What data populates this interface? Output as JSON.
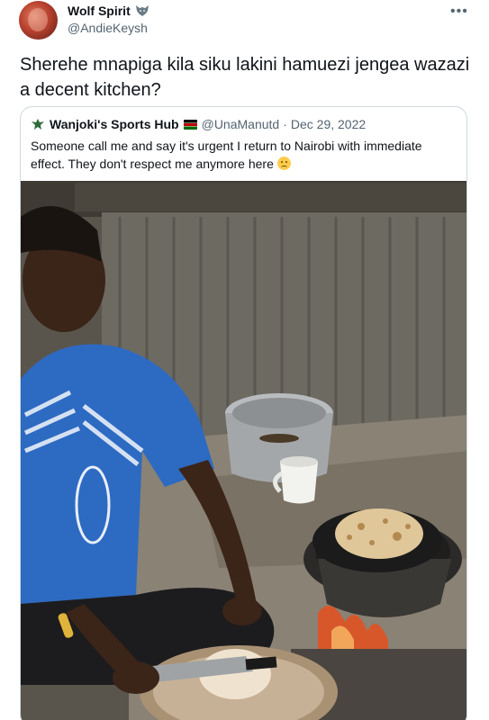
{
  "tweet": {
    "author_name": "Wolf Spirit",
    "author_handle": "@AndieKeysh",
    "text": "Sherehe mnapiga kila siku lakini hamuezi jengea wazazi a decent kitchen?",
    "more_icon": "more-horizontal-icon",
    "badge_icon": "wolf-icon"
  },
  "quoted_tweet": {
    "author_name": "Wanjoki's Sports Hub",
    "flag_icon": "kenya-flag-icon",
    "author_handle": "@UnaManutd",
    "separator": "·",
    "date": "Dec 29, 2022",
    "text": "Someone call me and say it's urgent I return to Nairobi with immediate effect. They don't respect me anymore here",
    "emoji": "worried-face-emoji",
    "logo_icon": "eagle-logo-icon"
  },
  "photo": {
    "subject": "photo-kitchen-chapati"
  },
  "colors": {
    "text_primary": "#0f1419",
    "text_secondary": "#536471",
    "border": "#cfd9de"
  }
}
